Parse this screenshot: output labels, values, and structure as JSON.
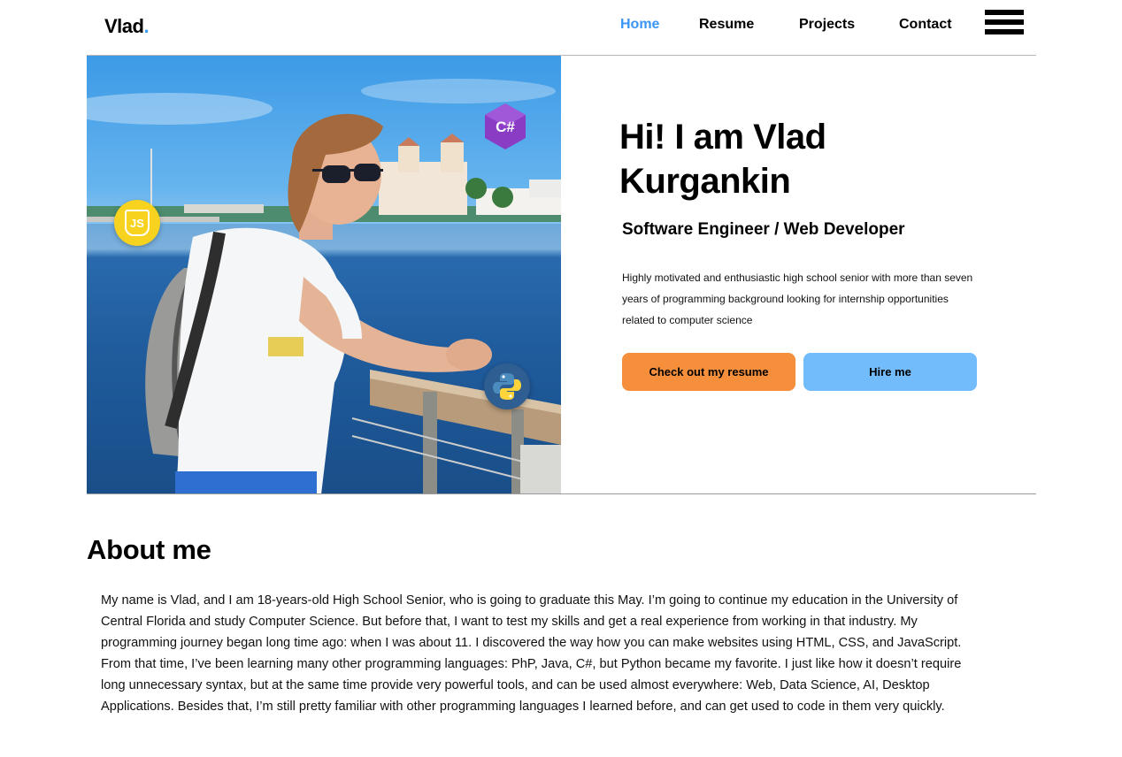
{
  "nav": {
    "logo_text": "Vlad",
    "logo_dot": ".",
    "links": [
      {
        "label": "Home",
        "active": true
      },
      {
        "label": "Resume",
        "active": false
      },
      {
        "label": "Projects",
        "active": false
      },
      {
        "label": "Contact",
        "active": false
      }
    ],
    "menu_icon": "hamburger-menu-icon"
  },
  "hero": {
    "title": "Hi! I am Vlad Kurgankin",
    "subtitle": "Software Engineer / Web Developer",
    "description": "Highly motivated and enthusiastic high school senior with more than seven years of programming background looking for internship opportunities related to computer science",
    "primary_button": "Check out my resume",
    "secondary_button": "Hire me",
    "badges": [
      {
        "icon": "javascript-icon",
        "text": "JS"
      },
      {
        "icon": "csharp-icon",
        "text": "C#"
      },
      {
        "icon": "python-icon"
      }
    ]
  },
  "about": {
    "title": "About me",
    "text": "My name is Vlad, and I am 18-years-old High School Senior, who is going to graduate this May. I’m going to continue my education in the University of Central Florida and study Computer Science. But before that, I want to test my skills and get a real experience from working in that industry. My programming journey began long time ago: when I was about 11. I discovered the way how you can make websites using HTML, CSS, and JavaScript. From that time, I’ve been learning many other programming languages: PhP, Java, C#, but Python became my favorite. I just like how it doesn’t require long unnecessary syntax, but at the same time provide very powerful tools, and can be used almost everywhere: Web, Data Science, AI, Desktop Applications. Besides that, I’m still pretty familiar with other programming languages I learned before, and can get used to code in them very quickly."
  },
  "colors": {
    "accent_blue": "#3a96f5",
    "resume_button": "#f58f3c",
    "hire_button": "#72bcfb",
    "js_yellow": "#f7d21e",
    "csharp_purple": "#8a3cc4",
    "python_blue": "#2f5e92"
  }
}
